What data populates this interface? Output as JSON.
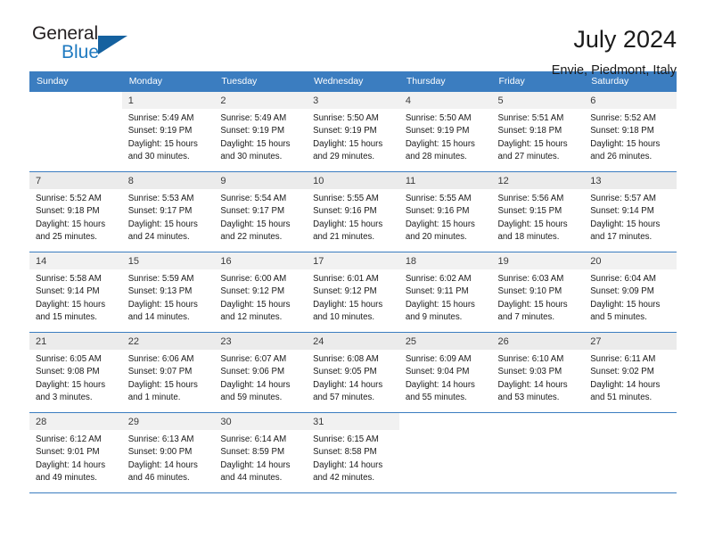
{
  "brand": {
    "name_part1": "General",
    "name_part2": "Blue",
    "triangle_color": "#15619f",
    "blue_color": "#1f7ac0"
  },
  "header": {
    "title": "July 2024",
    "subtitle": "Envie, Piedmont, Italy"
  },
  "theme": {
    "header_bar_color": "#3b7dc0",
    "daynum_band_color": "#f1f1f1",
    "shaded_row_color": "#ebebeb"
  },
  "weekday_headers": [
    "Sunday",
    "Monday",
    "Tuesday",
    "Wednesday",
    "Thursday",
    "Friday",
    "Saturday"
  ],
  "weeks": [
    {
      "shaded": false,
      "days": [
        {
          "day": "",
          "sunrise": "",
          "sunset": "",
          "daylight1": "",
          "daylight2": "",
          "empty": true
        },
        {
          "day": "1",
          "sunrise": "Sunrise: 5:49 AM",
          "sunset": "Sunset: 9:19 PM",
          "daylight1": "Daylight: 15 hours",
          "daylight2": "and 30 minutes.",
          "empty": false
        },
        {
          "day": "2",
          "sunrise": "Sunrise: 5:49 AM",
          "sunset": "Sunset: 9:19 PM",
          "daylight1": "Daylight: 15 hours",
          "daylight2": "and 30 minutes.",
          "empty": false
        },
        {
          "day": "3",
          "sunrise": "Sunrise: 5:50 AM",
          "sunset": "Sunset: 9:19 PM",
          "daylight1": "Daylight: 15 hours",
          "daylight2": "and 29 minutes.",
          "empty": false
        },
        {
          "day": "4",
          "sunrise": "Sunrise: 5:50 AM",
          "sunset": "Sunset: 9:19 PM",
          "daylight1": "Daylight: 15 hours",
          "daylight2": "and 28 minutes.",
          "empty": false
        },
        {
          "day": "5",
          "sunrise": "Sunrise: 5:51 AM",
          "sunset": "Sunset: 9:18 PM",
          "daylight1": "Daylight: 15 hours",
          "daylight2": "and 27 minutes.",
          "empty": false
        },
        {
          "day": "6",
          "sunrise": "Sunrise: 5:52 AM",
          "sunset": "Sunset: 9:18 PM",
          "daylight1": "Daylight: 15 hours",
          "daylight2": "and 26 minutes.",
          "empty": false
        }
      ]
    },
    {
      "shaded": true,
      "days": [
        {
          "day": "7",
          "sunrise": "Sunrise: 5:52 AM",
          "sunset": "Sunset: 9:18 PM",
          "daylight1": "Daylight: 15 hours",
          "daylight2": "and 25 minutes.",
          "empty": false
        },
        {
          "day": "8",
          "sunrise": "Sunrise: 5:53 AM",
          "sunset": "Sunset: 9:17 PM",
          "daylight1": "Daylight: 15 hours",
          "daylight2": "and 24 minutes.",
          "empty": false
        },
        {
          "day": "9",
          "sunrise": "Sunrise: 5:54 AM",
          "sunset": "Sunset: 9:17 PM",
          "daylight1": "Daylight: 15 hours",
          "daylight2": "and 22 minutes.",
          "empty": false
        },
        {
          "day": "10",
          "sunrise": "Sunrise: 5:55 AM",
          "sunset": "Sunset: 9:16 PM",
          "daylight1": "Daylight: 15 hours",
          "daylight2": "and 21 minutes.",
          "empty": false
        },
        {
          "day": "11",
          "sunrise": "Sunrise: 5:55 AM",
          "sunset": "Sunset: 9:16 PM",
          "daylight1": "Daylight: 15 hours",
          "daylight2": "and 20 minutes.",
          "empty": false
        },
        {
          "day": "12",
          "sunrise": "Sunrise: 5:56 AM",
          "sunset": "Sunset: 9:15 PM",
          "daylight1": "Daylight: 15 hours",
          "daylight2": "and 18 minutes.",
          "empty": false
        },
        {
          "day": "13",
          "sunrise": "Sunrise: 5:57 AM",
          "sunset": "Sunset: 9:14 PM",
          "daylight1": "Daylight: 15 hours",
          "daylight2": "and 17 minutes.",
          "empty": false
        }
      ]
    },
    {
      "shaded": false,
      "days": [
        {
          "day": "14",
          "sunrise": "Sunrise: 5:58 AM",
          "sunset": "Sunset: 9:14 PM",
          "daylight1": "Daylight: 15 hours",
          "daylight2": "and 15 minutes.",
          "empty": false
        },
        {
          "day": "15",
          "sunrise": "Sunrise: 5:59 AM",
          "sunset": "Sunset: 9:13 PM",
          "daylight1": "Daylight: 15 hours",
          "daylight2": "and 14 minutes.",
          "empty": false
        },
        {
          "day": "16",
          "sunrise": "Sunrise: 6:00 AM",
          "sunset": "Sunset: 9:12 PM",
          "daylight1": "Daylight: 15 hours",
          "daylight2": "and 12 minutes.",
          "empty": false
        },
        {
          "day": "17",
          "sunrise": "Sunrise: 6:01 AM",
          "sunset": "Sunset: 9:12 PM",
          "daylight1": "Daylight: 15 hours",
          "daylight2": "and 10 minutes.",
          "empty": false
        },
        {
          "day": "18",
          "sunrise": "Sunrise: 6:02 AM",
          "sunset": "Sunset: 9:11 PM",
          "daylight1": "Daylight: 15 hours",
          "daylight2": "and 9 minutes.",
          "empty": false
        },
        {
          "day": "19",
          "sunrise": "Sunrise: 6:03 AM",
          "sunset": "Sunset: 9:10 PM",
          "daylight1": "Daylight: 15 hours",
          "daylight2": "and 7 minutes.",
          "empty": false
        },
        {
          "day": "20",
          "sunrise": "Sunrise: 6:04 AM",
          "sunset": "Sunset: 9:09 PM",
          "daylight1": "Daylight: 15 hours",
          "daylight2": "and 5 minutes.",
          "empty": false
        }
      ]
    },
    {
      "shaded": true,
      "days": [
        {
          "day": "21",
          "sunrise": "Sunrise: 6:05 AM",
          "sunset": "Sunset: 9:08 PM",
          "daylight1": "Daylight: 15 hours",
          "daylight2": "and 3 minutes.",
          "empty": false
        },
        {
          "day": "22",
          "sunrise": "Sunrise: 6:06 AM",
          "sunset": "Sunset: 9:07 PM",
          "daylight1": "Daylight: 15 hours",
          "daylight2": "and 1 minute.",
          "empty": false
        },
        {
          "day": "23",
          "sunrise": "Sunrise: 6:07 AM",
          "sunset": "Sunset: 9:06 PM",
          "daylight1": "Daylight: 14 hours",
          "daylight2": "and 59 minutes.",
          "empty": false
        },
        {
          "day": "24",
          "sunrise": "Sunrise: 6:08 AM",
          "sunset": "Sunset: 9:05 PM",
          "daylight1": "Daylight: 14 hours",
          "daylight2": "and 57 minutes.",
          "empty": false
        },
        {
          "day": "25",
          "sunrise": "Sunrise: 6:09 AM",
          "sunset": "Sunset: 9:04 PM",
          "daylight1": "Daylight: 14 hours",
          "daylight2": "and 55 minutes.",
          "empty": false
        },
        {
          "day": "26",
          "sunrise": "Sunrise: 6:10 AM",
          "sunset": "Sunset: 9:03 PM",
          "daylight1": "Daylight: 14 hours",
          "daylight2": "and 53 minutes.",
          "empty": false
        },
        {
          "day": "27",
          "sunrise": "Sunrise: 6:11 AM",
          "sunset": "Sunset: 9:02 PM",
          "daylight1": "Daylight: 14 hours",
          "daylight2": "and 51 minutes.",
          "empty": false
        }
      ]
    },
    {
      "shaded": false,
      "days": [
        {
          "day": "28",
          "sunrise": "Sunrise: 6:12 AM",
          "sunset": "Sunset: 9:01 PM",
          "daylight1": "Daylight: 14 hours",
          "daylight2": "and 49 minutes.",
          "empty": false
        },
        {
          "day": "29",
          "sunrise": "Sunrise: 6:13 AM",
          "sunset": "Sunset: 9:00 PM",
          "daylight1": "Daylight: 14 hours",
          "daylight2": "and 46 minutes.",
          "empty": false
        },
        {
          "day": "30",
          "sunrise": "Sunrise: 6:14 AM",
          "sunset": "Sunset: 8:59 PM",
          "daylight1": "Daylight: 14 hours",
          "daylight2": "and 44 minutes.",
          "empty": false
        },
        {
          "day": "31",
          "sunrise": "Sunrise: 6:15 AM",
          "sunset": "Sunset: 8:58 PM",
          "daylight1": "Daylight: 14 hours",
          "daylight2": "and 42 minutes.",
          "empty": false
        },
        {
          "day": "",
          "sunrise": "",
          "sunset": "",
          "daylight1": "",
          "daylight2": "",
          "empty": true
        },
        {
          "day": "",
          "sunrise": "",
          "sunset": "",
          "daylight1": "",
          "daylight2": "",
          "empty": true
        },
        {
          "day": "",
          "sunrise": "",
          "sunset": "",
          "daylight1": "",
          "daylight2": "",
          "empty": true
        }
      ]
    }
  ]
}
